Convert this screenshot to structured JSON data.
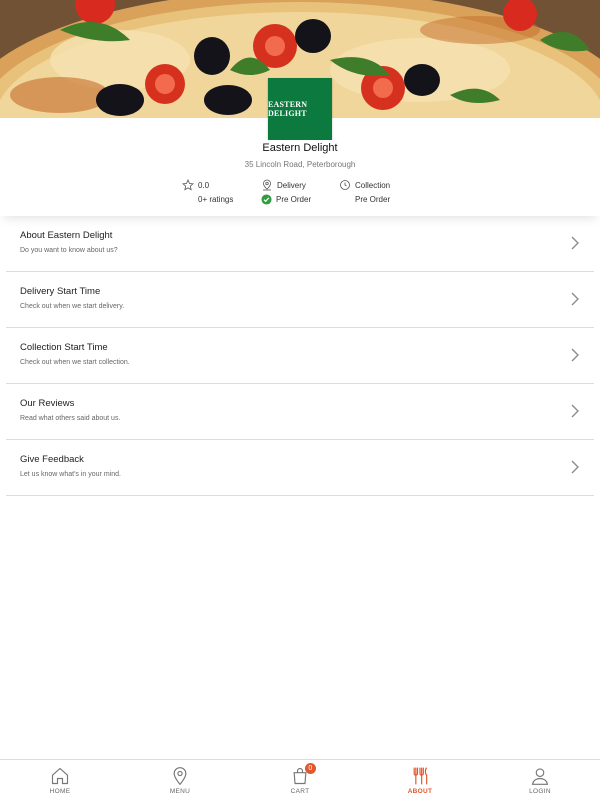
{
  "restaurant": {
    "logo_text": "EASTERN DELIGHT",
    "name": "Eastern Delight",
    "address": "35 Lincoln Road, Peterborough",
    "rating": "0.0",
    "ratings_count": "0+ ratings",
    "delivery_label": "Delivery",
    "delivery_status": "Pre Order",
    "collection_label": "Collection",
    "collection_status": "Pre Order",
    "brand_color": "#0c7a3f",
    "status_color": "#2e9e3f"
  },
  "menu_items": [
    {
      "title": "About Eastern Delight",
      "subtitle": "Do you want to know about us?"
    },
    {
      "title": "Delivery Start Time",
      "subtitle": "Check out when we start delivery."
    },
    {
      "title": "Collection Start Time",
      "subtitle": "Check out when we start collection."
    },
    {
      "title": "Our Reviews",
      "subtitle": "Read what others said about us."
    },
    {
      "title": "Give Feedback",
      "subtitle": "Let us know what's in your mind."
    }
  ],
  "tabbar": {
    "accent_color": "#e2572b",
    "cart_count": "0",
    "tabs": [
      {
        "label": "HOME",
        "icon": "home-icon"
      },
      {
        "label": "MENU",
        "icon": "location-pin-icon"
      },
      {
        "label": "CART",
        "icon": "shopping-bag-icon"
      },
      {
        "label": "ABOUT",
        "icon": "cutlery-icon"
      },
      {
        "label": "LOGIN",
        "icon": "user-icon"
      }
    ],
    "active_tab": "ABOUT"
  }
}
